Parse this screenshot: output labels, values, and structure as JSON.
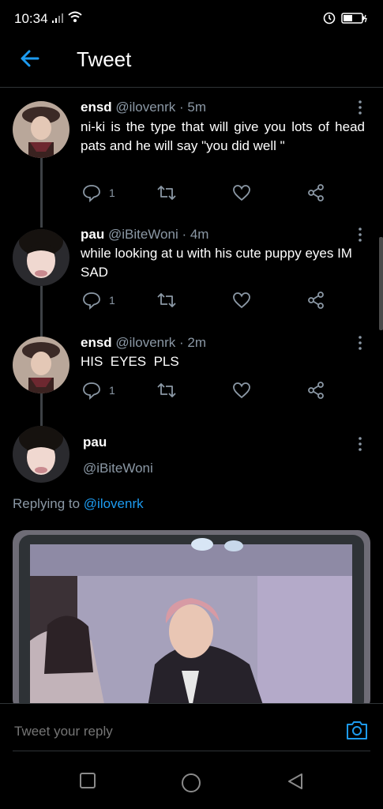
{
  "status": {
    "time": "10:34"
  },
  "header": {
    "title": "Tweet"
  },
  "tweets": [
    {
      "name": "ensd",
      "handle": "@ilovenrk",
      "time": "· 5m",
      "text": "ni-ki is the type that will give you lots of head pats and he will say  \"you did well \"",
      "replies": "1"
    },
    {
      "name": "pau",
      "handle": "@iBiteWoni",
      "time": "· 4m",
      "text": "while looking at u with his cute puppy eyes IM SAD",
      "replies": "1"
    },
    {
      "name": "ensd",
      "handle": "@ilovenrk",
      "time": "· 2m",
      "text": "HIS  EYES  PLS",
      "replies": "1"
    }
  ],
  "main": {
    "name": "pau",
    "handle": "@iBiteWoni",
    "replying_prefix": "Replying to ",
    "replying_handle": "@ilovenrk"
  },
  "reply": {
    "placeholder": "Tweet your reply"
  },
  "colors": {
    "accent": "#1d9bf0",
    "muted": "#8b98a5",
    "background": "#000000"
  }
}
